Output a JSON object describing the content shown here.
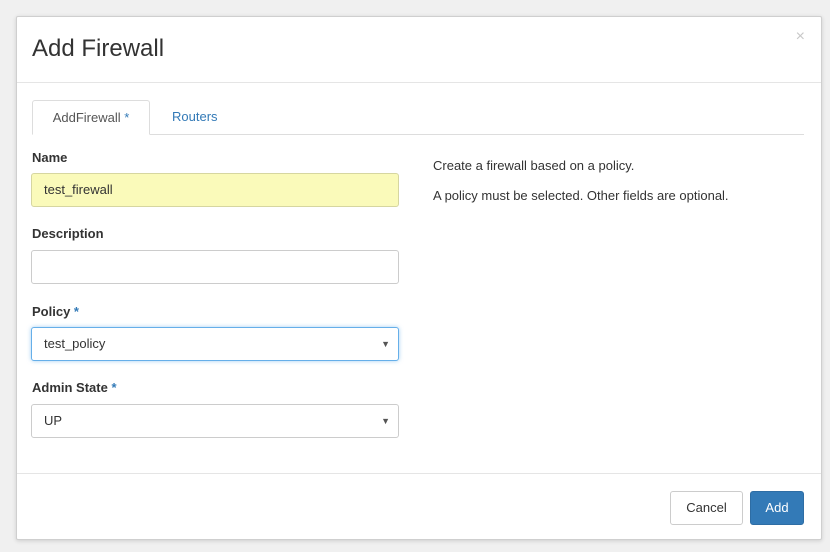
{
  "modal": {
    "title": "Add Firewall",
    "close_symbol": "×"
  },
  "tabs": [
    {
      "label": "AddFirewall",
      "required_mark": "*",
      "active": true
    },
    {
      "label": "Routers",
      "active": false
    }
  ],
  "form": {
    "name": {
      "label": "Name",
      "value": "test_firewall"
    },
    "description": {
      "label": "Description",
      "value": ""
    },
    "policy": {
      "label": "Policy",
      "required_mark": "*",
      "selected": "test_policy"
    },
    "admin_state": {
      "label": "Admin State",
      "required_mark": "*",
      "selected": "UP"
    }
  },
  "help": {
    "line1": "Create a firewall based on a policy.",
    "line2": "A policy must be selected. Other fields are optional."
  },
  "footer": {
    "cancel_label": "Cancel",
    "add_label": "Add"
  },
  "icons": {
    "close": "close-icon",
    "dropdown": "chevron-down-icon"
  },
  "colors": {
    "primary": "#337ab7",
    "autofill": "#fafaba"
  }
}
